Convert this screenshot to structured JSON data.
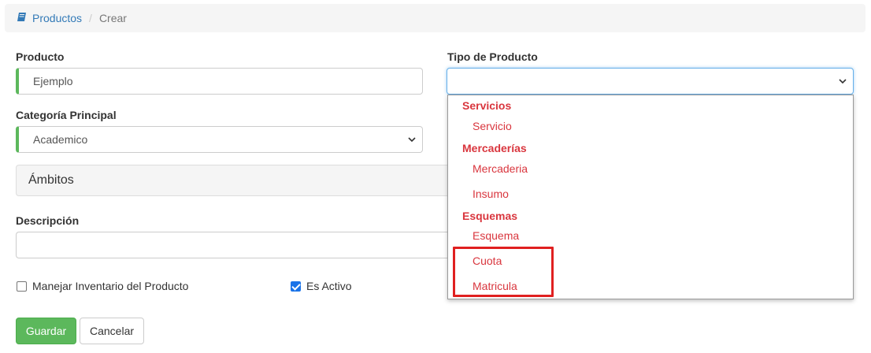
{
  "breadcrumb": {
    "parent": "Productos",
    "separator": "/",
    "current": "Crear"
  },
  "form": {
    "producto": {
      "label": "Producto",
      "value": "Ejemplo"
    },
    "tipo": {
      "label": "Tipo de Producto",
      "value": ""
    },
    "categoria": {
      "label": "Categoría Principal",
      "value": "Academico"
    },
    "ambitos": {
      "label": "Ámbitos"
    },
    "descripcion": {
      "label": "Descripción",
      "value": ""
    },
    "inventario": {
      "label": "Manejar Inventario del Producto",
      "checked": false
    },
    "activo": {
      "label": "Es Activo",
      "checked": true
    }
  },
  "buttons": {
    "save": "Guardar",
    "cancel": "Cancelar"
  },
  "dropdown": {
    "groups": [
      {
        "label": "Servicios",
        "options": [
          "Servicio"
        ]
      },
      {
        "label": "Mercaderías",
        "options": [
          "Mercaderia",
          "Insumo"
        ]
      },
      {
        "label": "Esquemas",
        "options": [
          "Esquema",
          "Cuota",
          "Matricula"
        ]
      }
    ]
  },
  "colors": {
    "primary": "#337ab7",
    "success": "#5cb85c",
    "option_text": "#d9363e",
    "highlight": "#e02020",
    "checkbox": "#1a73e8"
  }
}
